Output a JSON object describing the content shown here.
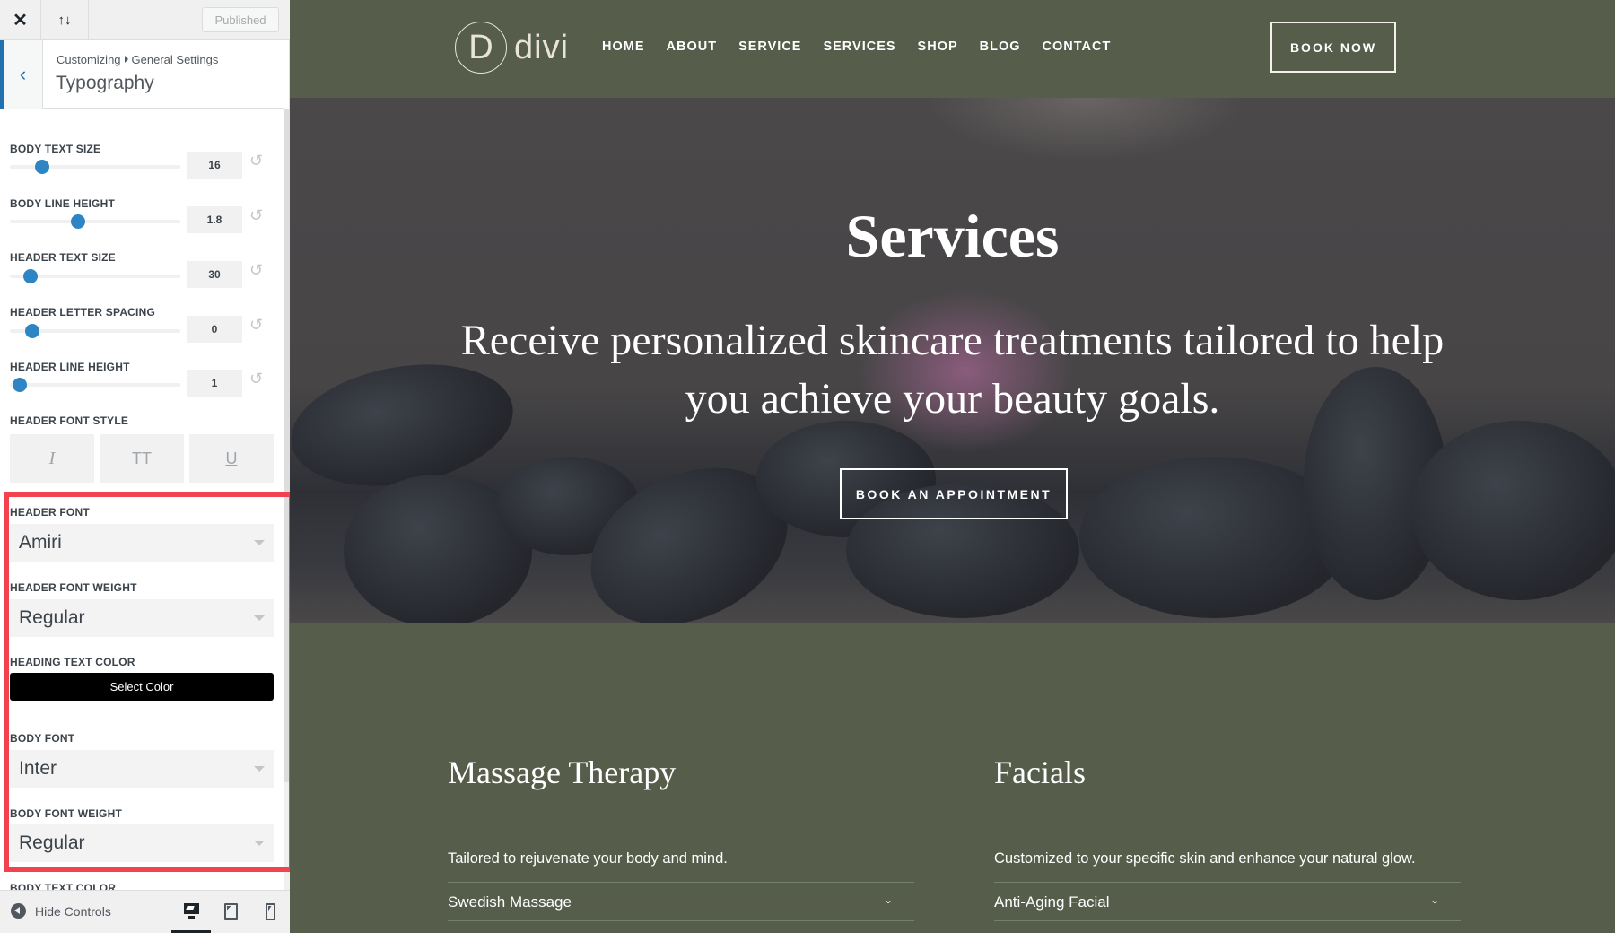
{
  "customizer": {
    "topbar": {
      "close_icon": "close-icon",
      "reorder_icon": "arrows-up-down-icon",
      "close_glyph": "✕",
      "reorder_glyph": "↑↓",
      "publish_label": "Published"
    },
    "section": {
      "back_glyph": "‹",
      "breadcrumb_root": "Customizing",
      "breadcrumb_parent": "General Settings",
      "title": "Typography"
    },
    "sliders": [
      {
        "label": "Body Text Size",
        "value": "16",
        "fill_fraction": 0.19
      },
      {
        "label": "Body Line Height",
        "value": "1.8",
        "fill_fraction": 0.4
      },
      {
        "label": "Header Text Size",
        "value": "30",
        "fill_fraction": 0.12
      },
      {
        "label": "Header Letter Spacing",
        "value": "0",
        "fill_fraction": 0.13
      },
      {
        "label": "Header Line Height",
        "value": "1",
        "fill_fraction": 0.06
      }
    ],
    "reset_glyph": "↺",
    "font_style": {
      "label": "Header Font Style",
      "buttons": [
        {
          "name": "italic",
          "glyph": "I"
        },
        {
          "name": "uppercase",
          "glyph": "TT"
        },
        {
          "name": "underline",
          "glyph": "U"
        }
      ]
    },
    "header_font": {
      "label": "Header Font",
      "value": "Amiri"
    },
    "header_font_weight": {
      "label": "Header Font Weight",
      "value": "Regular"
    },
    "heading_text_color": {
      "label": "Heading Text Color",
      "button_label": "Select Color"
    },
    "body_font": {
      "label": "Body Font",
      "value": "Inter"
    },
    "body_font_weight": {
      "label": "Body Font Weight",
      "value": "Regular"
    },
    "body_text_color": {
      "label": "Body Text Color"
    },
    "footer": {
      "hide_controls_label": "Hide Controls",
      "devices": [
        "desktop",
        "tablet",
        "mobile"
      ],
      "active_device": "desktop"
    },
    "highlight_color": "#f2414f",
    "accent_color": "#2e85c4"
  },
  "site": {
    "logo": {
      "mark": "D",
      "text": "divi"
    },
    "nav": [
      "HOME",
      "ABOUT",
      "SERVICE",
      "SERVICES",
      "SHOP",
      "BLOG",
      "CONTACT"
    ],
    "cta_label": "BOOK NOW",
    "hero": {
      "title": "Services",
      "subtitle": "Receive personalized skincare treatments tailored to help you achieve your beauty goals.",
      "button_label": "BOOK AN APPOINTMENT"
    },
    "services": [
      {
        "title": "Massage Therapy",
        "description": "Tailored to rejuvenate your body and mind.",
        "accordion_item": "Swedish Massage"
      },
      {
        "title": "Facials",
        "description": "Customized to your specific skin and enhance your natural glow.",
        "accordion_item": "Anti-Aging Facial"
      }
    ],
    "brand_color": "#565d4a"
  }
}
